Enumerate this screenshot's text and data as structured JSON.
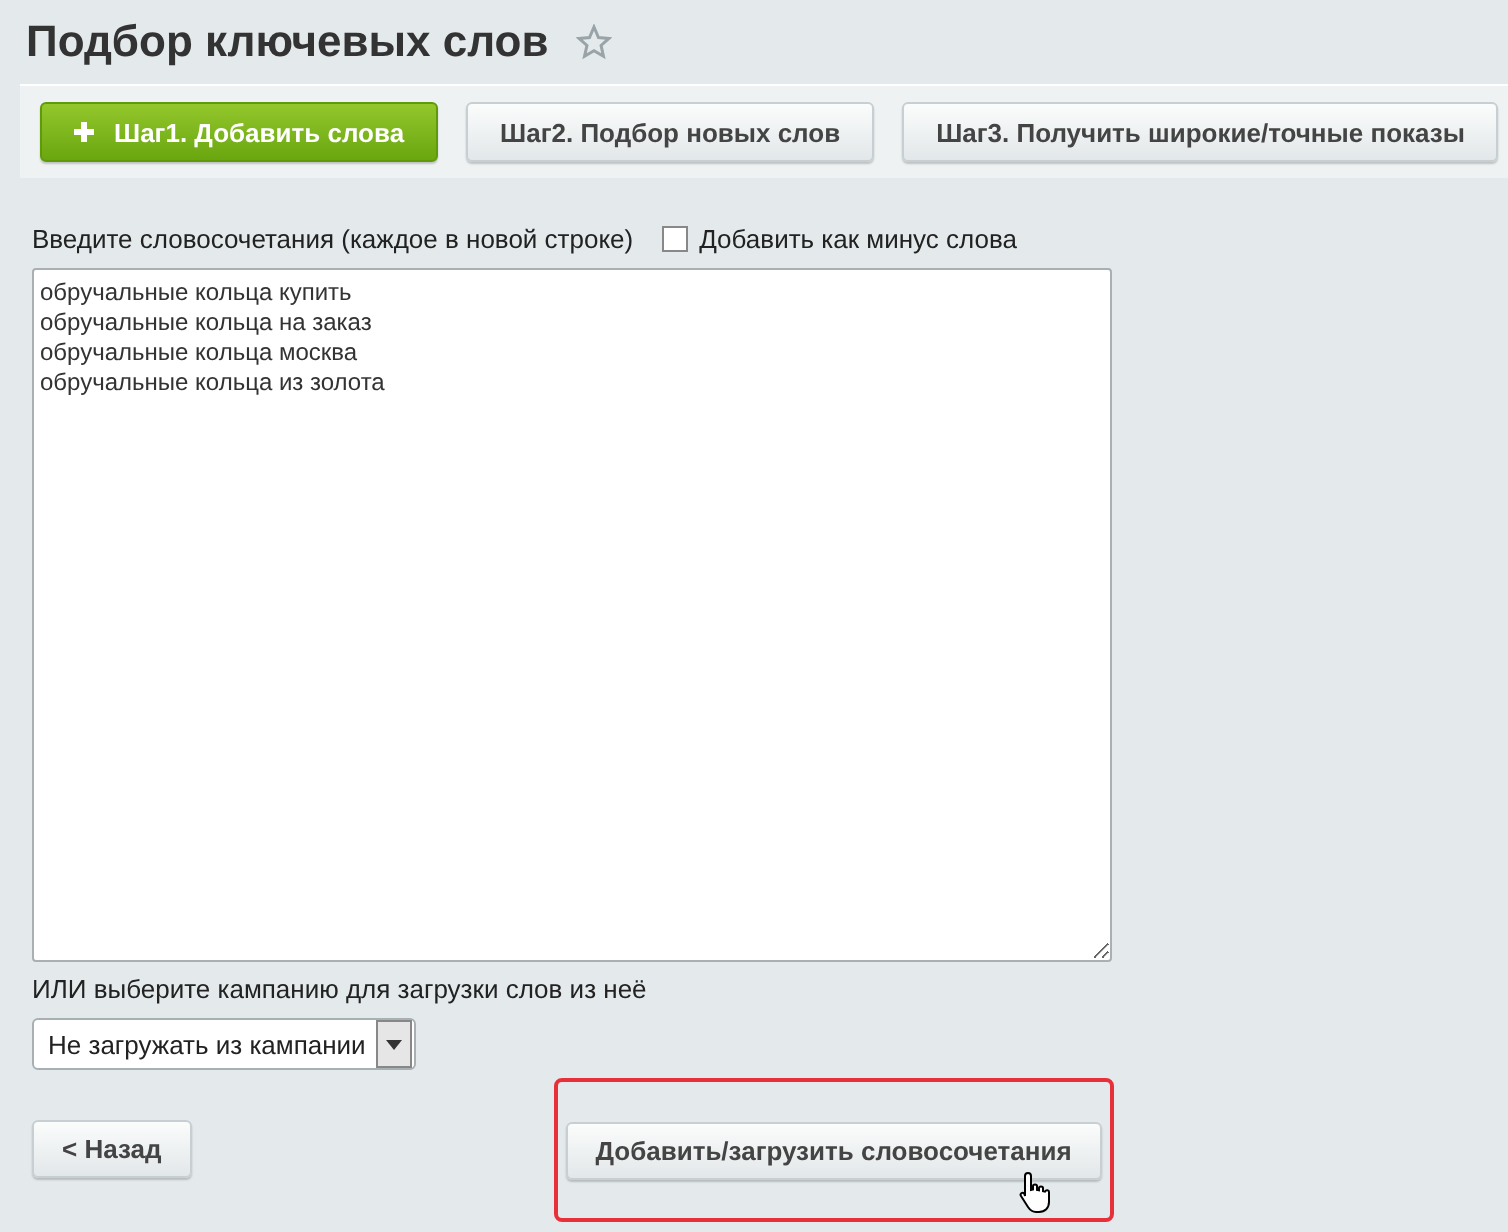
{
  "title": "Подбор ключевых слов",
  "steps": [
    {
      "label": "Шаг1. Добавить слова",
      "selected": true
    },
    {
      "label": "Шаг2. Подбор новых слов",
      "selected": false
    },
    {
      "label": "Шаг3. Получить широкие/точные показы",
      "selected": false
    }
  ],
  "phrases_label": "Введите словосочетания (каждое в новой строке)",
  "minus_words": {
    "label": "Добавить как минус слова",
    "checked": false
  },
  "phrases": [
    "обручальные кольца купить",
    "обручальные кольца на заказ",
    "обручальные кольца москва",
    "обручальные кольца из золота"
  ],
  "campaign_label": "ИЛИ выберите кампанию для загрузки слов из неё",
  "campaign_select": {
    "value": "Не загружать из кампании"
  },
  "back_button": "< Назад",
  "submit_button": "Добавить/загрузить словосочетания"
}
